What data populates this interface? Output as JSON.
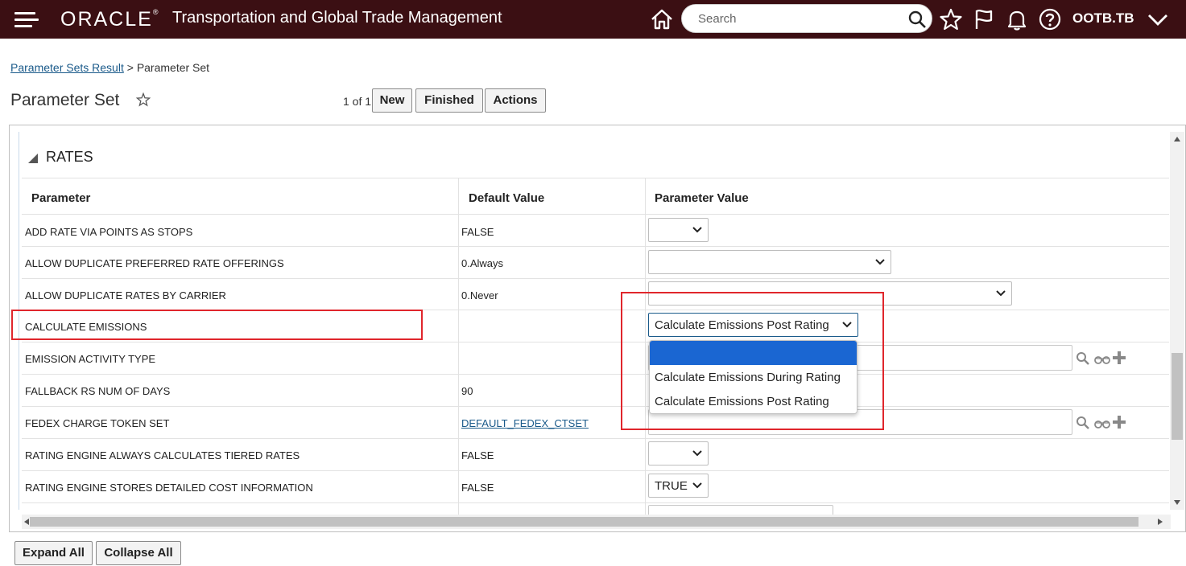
{
  "header": {
    "logo": "ORACLE",
    "logo_mark": "®",
    "app_title": "Transportation and Global Trade Management",
    "search_placeholder": "Search",
    "user": "OOTB.TB",
    "icons": [
      "menu-icon",
      "home-icon",
      "search-icon",
      "star-icon",
      "flag-icon",
      "bell-icon",
      "help-icon",
      "chevron-down-icon"
    ]
  },
  "breadcrumb": {
    "link": "Parameter Sets Result",
    "separator": ">",
    "current": "Parameter Set"
  },
  "page": {
    "title": "Parameter Set",
    "pager": "1 of 1",
    "buttons": {
      "new": "New",
      "finished": "Finished",
      "actions": "Actions"
    }
  },
  "section": {
    "title": "RATES",
    "columns": {
      "parameter": "Parameter",
      "default": "Default Value",
      "value": "Parameter Value"
    },
    "rows": [
      {
        "parameter": "ADD RATE VIA POINTS AS STOPS",
        "default": "FALSE",
        "value": ""
      },
      {
        "parameter": "ALLOW DUPLICATE PREFERRED RATE OFFERINGS",
        "default": "0.Always",
        "value": ""
      },
      {
        "parameter": "ALLOW DUPLICATE RATES BY CARRIER",
        "default": "0.Never",
        "value": ""
      },
      {
        "parameter": "CALCULATE EMISSIONS",
        "default": "",
        "value": "Calculate Emissions Post Rating"
      },
      {
        "parameter": "EMISSION ACTIVITY TYPE",
        "default": "",
        "value": ""
      },
      {
        "parameter": "FALLBACK RS NUM OF DAYS",
        "default": "90",
        "value": ""
      },
      {
        "parameter": "FEDEX CHARGE TOKEN SET",
        "default": "DEFAULT_FEDEX_CTSET",
        "value": ""
      },
      {
        "parameter": "RATING ENGINE ALWAYS CALCULATES TIERED RATES",
        "default": "FALSE",
        "value": ""
      },
      {
        "parameter": "RATING ENGINE STORES DETAILED COST INFORMATION",
        "default": "FALSE",
        "value": "TRUE"
      }
    ]
  },
  "dropdown": {
    "options": [
      "",
      "Calculate Emissions During Rating",
      "Calculate Emissions Post Rating"
    ],
    "highlighted_index": 0
  },
  "footer": {
    "expand_all": "Expand All",
    "collapse_all": "Collapse All"
  },
  "colors": {
    "header_bg": "#3b0f13",
    "highlight": "#1a66d2",
    "annotation": "#e0262c",
    "link": "#1a5a8a"
  }
}
